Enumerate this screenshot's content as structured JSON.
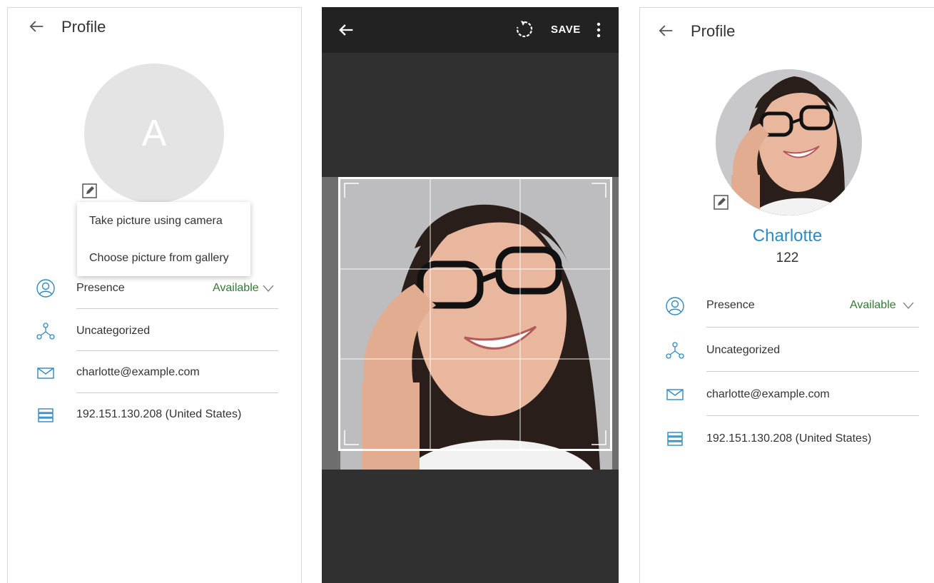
{
  "screens": {
    "profile_menu": {
      "title": "Profile",
      "avatar_initial": "A",
      "menu_items": [
        "Take picture using camera",
        "Choose picture from gallery"
      ],
      "presence_label": "Presence",
      "presence_status": "Available",
      "category": "Uncategorized",
      "email": "charlotte@example.com",
      "ip": "192.151.130.208 (United States)"
    },
    "crop_editor": {
      "save_label": "SAVE"
    },
    "profile_done": {
      "title": "Profile",
      "name": "Charlotte",
      "extension": "122",
      "presence_label": "Presence",
      "presence_status": "Available",
      "category": "Uncategorized",
      "email": "charlotte@example.com",
      "ip": "192.151.130.208 (United States)"
    }
  },
  "icons": [
    "back-arrow-icon",
    "edit-pencil-icon",
    "presence-person-icon",
    "category-nodes-icon",
    "email-envelope-icon",
    "server-ip-icon",
    "rotate-icon",
    "more-vertical-icon",
    "chevron-down-icon"
  ],
  "colors": {
    "accent_blue": "#2f8ac1",
    "available_green": "#2e7d32",
    "editor_background": "#303030",
    "editor_toolbar": "#222222"
  }
}
